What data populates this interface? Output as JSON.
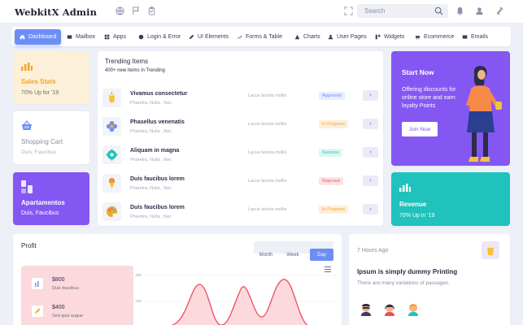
{
  "app": {
    "title": "WebkitX Admin"
  },
  "header": {
    "search_placeholder": "Search"
  },
  "nav": {
    "items": [
      {
        "label": "Dashboard",
        "icon": "home-icon",
        "active": true
      },
      {
        "label": "Mailbox",
        "icon": "mail-icon"
      },
      {
        "label": "Apps",
        "icon": "apps-icon"
      },
      {
        "label": "Login & Error",
        "icon": "lock-icon"
      },
      {
        "label": "UI Elements",
        "icon": "pen-icon"
      },
      {
        "label": "Forms & Table",
        "icon": "table-icon"
      },
      {
        "label": "Charts",
        "icon": "chart-icon"
      },
      {
        "label": "User Pages",
        "icon": "user-icon"
      },
      {
        "label": "Widgets",
        "icon": "widget-icon"
      },
      {
        "label": "Ecommerce",
        "icon": "cart-icon"
      },
      {
        "label": "Emails",
        "icon": "envelope-icon"
      }
    ]
  },
  "sales": {
    "title": "Sales Stats",
    "sub": "70% Up for '19"
  },
  "cart": {
    "title": "Shopping Cart",
    "sub": "Duis, Faucibus"
  },
  "apart": {
    "title": "Apartamentos",
    "sub": "Duis, Faucibus"
  },
  "trending": {
    "title": "Trending Items",
    "sub": "400+ new Items in Trending",
    "rows": [
      {
        "name": "Vivamus consectetur",
        "meta": "Pharetra, Nulla , Nec",
        "lacus": "Lacus lacinia mollis",
        "status": "Approved",
        "status_bg": "#e6edfd",
        "status_fg": "#6c8ef5"
      },
      {
        "name": "Phasellus venenatis",
        "meta": "Pharetra, Nulla , Nec",
        "lacus": "Lacus lacinia mollis",
        "status": "In Progress",
        "status_bg": "#fdeedd",
        "status_fg": "#f2a726"
      },
      {
        "name": "Aliquam in magna",
        "meta": "Pharetra, Nulla , Nec",
        "lacus": "Lacus lacinia mollis",
        "status": "Success",
        "status_bg": "#dcf7f3",
        "status_fg": "#1fc2bc"
      },
      {
        "name": "Duis faucibus lorem",
        "meta": "Pharetra, Nulla , Nec",
        "lacus": "Lacus lacinia mollis",
        "status": "Rejected",
        "status_bg": "#fde3e6",
        "status_fg": "#f2545b"
      },
      {
        "name": "Duis faucibus lorem",
        "meta": "Pharetra, Nulla , Nec",
        "lacus": "Lacus lacinia mollis",
        "status": "In Progress",
        "status_bg": "#fdeedd",
        "status_fg": "#f2a726"
      }
    ]
  },
  "start": {
    "title": "Start Now",
    "desc": "Offering discounts for online store and earn loyalty Points",
    "button": "Join Now"
  },
  "revenue": {
    "title": "Revenue",
    "sub": "70% Up in '19"
  },
  "profit": {
    "title": "Profit",
    "tabs": [
      {
        "label": "Month"
      },
      {
        "label": "Week"
      },
      {
        "label": "Day",
        "active": true
      }
    ],
    "items": [
      {
        "value": "$800",
        "label": "Duis faucibus"
      },
      {
        "value": "$400",
        "label": "Sed quis augue"
      }
    ],
    "yticks": [
      "16K",
      "12K"
    ]
  },
  "ipsum": {
    "time": "7 Hours Ago",
    "title": "Ipsum is simply dummy Printing",
    "text": "There are many variations of passages."
  },
  "colors": {
    "accent": "#6c8ef5",
    "purple": "#8457f3",
    "teal": "#1fc2bc",
    "orange": "#f2a726",
    "chart_red": "#ef4b5c"
  }
}
